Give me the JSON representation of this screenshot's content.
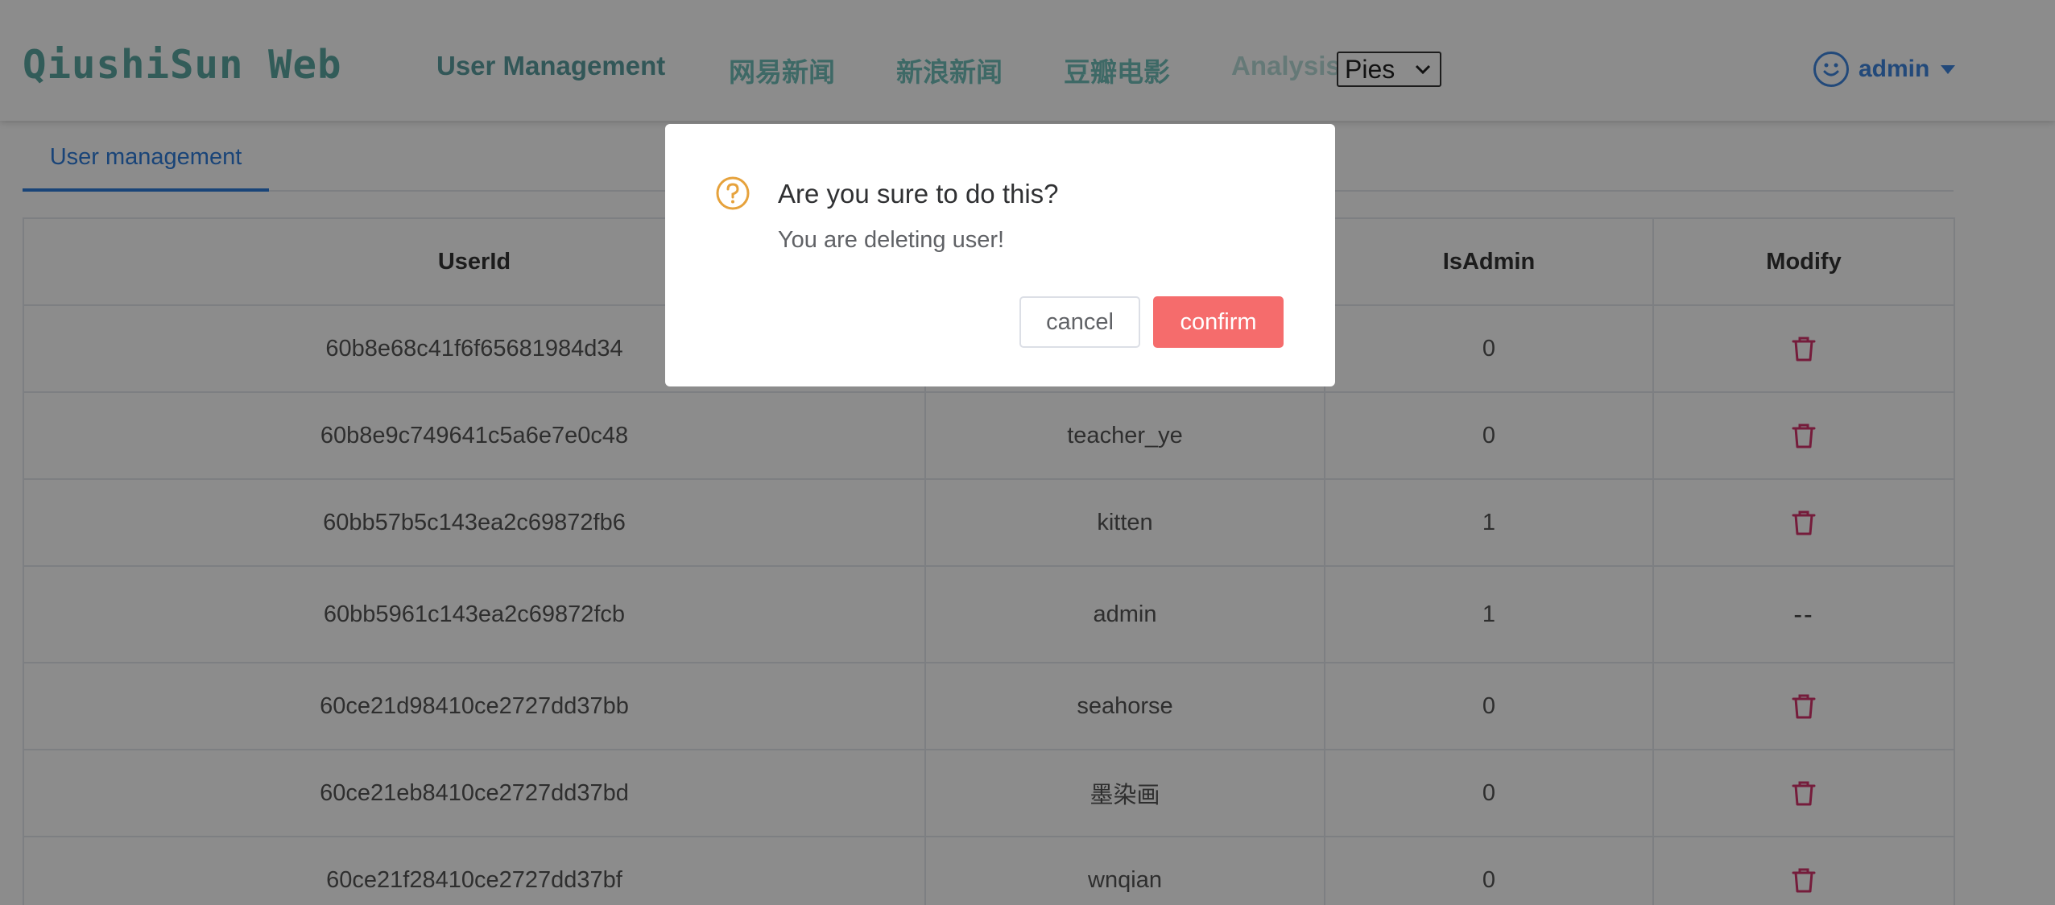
{
  "header": {
    "logo": "QiushiSun Web",
    "nav": [
      {
        "label": "User Management"
      },
      {
        "label": "网易新闻"
      },
      {
        "label": "新浪新闻"
      },
      {
        "label": "豆瓣电影"
      },
      {
        "label": "Analysis"
      }
    ],
    "analysis_select": {
      "selected": "Pies"
    },
    "user": {
      "name": "admin"
    }
  },
  "tabs": [
    {
      "label": "User management"
    }
  ],
  "table": {
    "columns": [
      "UserId",
      "",
      "IsAdmin",
      "Modify"
    ],
    "rows": [
      {
        "userid": "60b8e68c41f6f65681984d34",
        "username": "",
        "isadmin": "0",
        "modify": "delete"
      },
      {
        "userid": "60b8e9c749641c5a6e7e0c48",
        "username": "teacher_ye",
        "isadmin": "0",
        "modify": "delete"
      },
      {
        "userid": "60bb57b5c143ea2c69872fb6",
        "username": "kitten",
        "isadmin": "1",
        "modify": "delete"
      },
      {
        "userid": "60bb5961c143ea2c69872fcb",
        "username": "admin",
        "isadmin": "1",
        "modify": "--"
      },
      {
        "userid": "60ce21d98410ce2727dd37bb",
        "username": "seahorse",
        "isadmin": "0",
        "modify": "delete"
      },
      {
        "userid": "60ce21eb8410ce2727dd37bd",
        "username": "墨染画",
        "isadmin": "0",
        "modify": "delete"
      },
      {
        "userid": "60ce21f28410ce2727dd37bf",
        "username": "wnqian",
        "isadmin": "0",
        "modify": "delete"
      }
    ]
  },
  "dialog": {
    "title": "Are you sure to do this?",
    "message": "You are deleting user!",
    "cancel_label": "cancel",
    "confirm_label": "confirm"
  },
  "colors": {
    "accent_blue": "#2f7ddb",
    "nav_teal": "#71c0bb",
    "danger": "#f56c6c",
    "trash_icon": "#d6336c",
    "warning": "#e6a23c"
  },
  "icons": {
    "user_menu": "smile-icon",
    "user_caret": "caret-down-icon",
    "dialog": "question-circle-icon",
    "row_delete": "trash-icon"
  }
}
